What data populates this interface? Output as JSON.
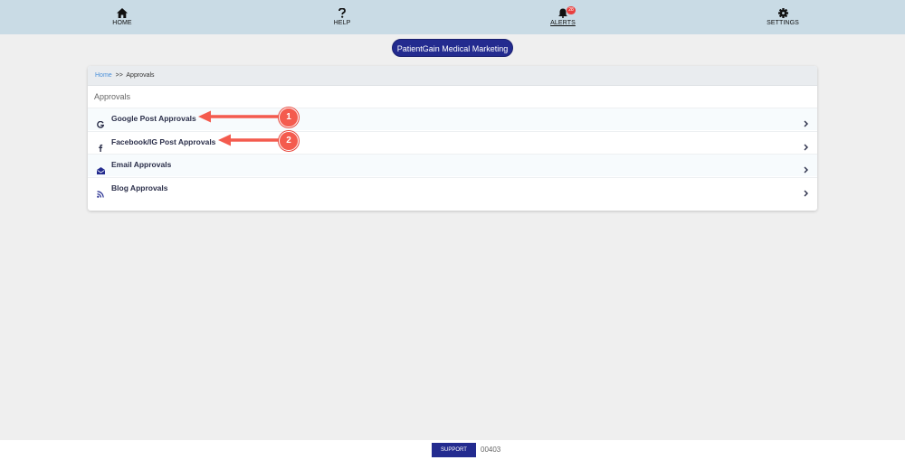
{
  "nav": {
    "items": [
      {
        "label": "HOME",
        "icon": "home-icon"
      },
      {
        "label": "HELP",
        "icon": "question-icon"
      },
      {
        "label": "ALERTS",
        "icon": "bell-icon",
        "badge": "28"
      },
      {
        "label": "SETTINGS",
        "icon": "gear-icon"
      }
    ]
  },
  "practice": {
    "label": "PatientGain Medical Marketing"
  },
  "breadcrumb": {
    "home": "Home",
    "separator": ">>",
    "current": "Approvals"
  },
  "section": {
    "title": "Approvals"
  },
  "approvals": [
    {
      "label": "Google Post Approvals",
      "icon": "google-icon"
    },
    {
      "label": "Facebook/IG Post Approvals",
      "icon": "facebook-icon"
    },
    {
      "label": "Email Approvals",
      "icon": "envelope-open-icon"
    },
    {
      "label": "Blog Approvals",
      "icon": "rss-icon"
    }
  ],
  "annotations": [
    {
      "number": "1"
    },
    {
      "number": "2"
    }
  ],
  "footer": {
    "support_label": "SUPPORT",
    "code": "00403"
  },
  "colors": {
    "nav_bg": "#c9dbe5",
    "brand": "#232b8f",
    "annotation": "#f45b4e",
    "link": "#4a90d9"
  }
}
